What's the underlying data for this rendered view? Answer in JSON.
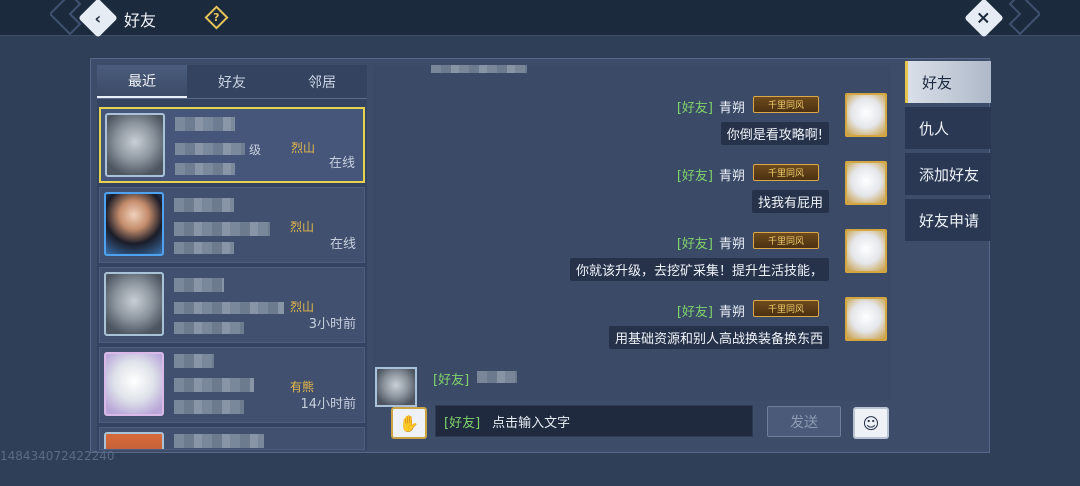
{
  "header": {
    "title": "好友",
    "help_icon": "question-diamond-icon",
    "back_icon": "chevron-left-icon",
    "close_icon": "close-icon"
  },
  "tabs": [
    {
      "label": "最近",
      "active": true
    },
    {
      "label": "好友",
      "active": false
    },
    {
      "label": "邻居",
      "active": false
    }
  ],
  "contacts": [
    {
      "level_suffix": "级",
      "guild": "烈山",
      "status": "在线",
      "selected": true
    },
    {
      "guild": "烈山",
      "status": "在线",
      "selected": false
    },
    {
      "guild": "烈山",
      "status": "3小时前",
      "selected": false
    },
    {
      "guild": "有熊",
      "status": "14小时前",
      "selected": false
    }
  ],
  "chat": {
    "messages": [
      {
        "channel": "[好友]",
        "sender": "青朔",
        "badge": "千里同风",
        "text": "你倒是看攻略啊!"
      },
      {
        "channel": "[好友]",
        "sender": "青朔",
        "badge": "千里同风",
        "text": "找我有屁用"
      },
      {
        "channel": "[好友]",
        "sender": "青朔",
        "badge": "千里同风",
        "text": "你就该升级，去挖矿采集！提升生活技能，"
      },
      {
        "channel": "[好友]",
        "sender": "青朔",
        "badge": "千里同风",
        "text": "用基础资源和别人高战换装备换东西"
      }
    ],
    "incoming_channel": "[好友]"
  },
  "input": {
    "channel": "[好友]",
    "placeholder": "点击输入文字",
    "send_label": "发送"
  },
  "side_menu": [
    {
      "label": "好友",
      "active": true
    },
    {
      "label": "仇人",
      "active": false
    },
    {
      "label": "添加好友",
      "active": false
    },
    {
      "label": "好友申请",
      "active": false
    }
  ],
  "watermark": "148434072422240",
  "colors": {
    "accent_gold": "#e7d24f",
    "channel_green": "#7fd26a",
    "panel_bg": "#3d4d69"
  }
}
